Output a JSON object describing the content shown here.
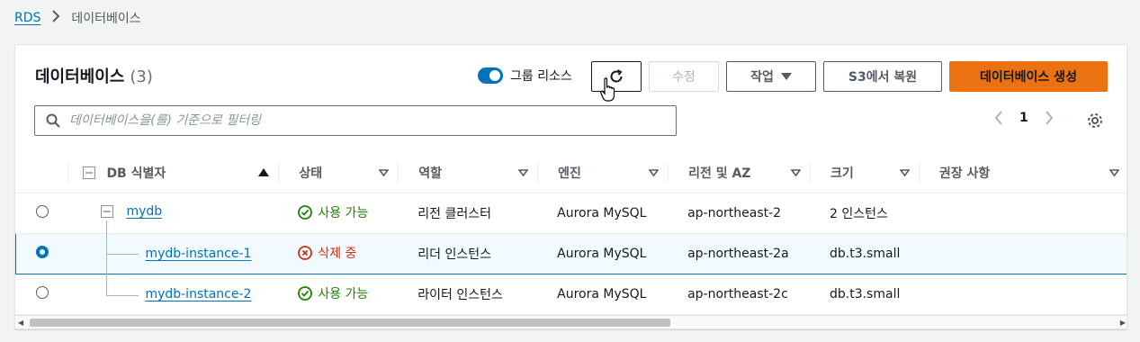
{
  "breadcrumb": {
    "root": "RDS",
    "current": "데이터베이스"
  },
  "header": {
    "title": "데이터베이스",
    "count": "(3)"
  },
  "toolbar": {
    "group_toggle_label": "그룹 리소스",
    "modify_label": "수정",
    "actions_label": "작업",
    "restore_label": "S3에서 복원",
    "create_label": "데이터베이스 생성"
  },
  "search": {
    "placeholder": "데이터베이스을(를) 기준으로 필터링",
    "value": ""
  },
  "pagination": {
    "page": "1"
  },
  "table": {
    "columns": [
      "DB 식별자",
      "상태",
      "역할",
      "엔진",
      "리전 및 AZ",
      "크기",
      "권장 사항"
    ],
    "rows": [
      {
        "id": "mydb",
        "status": "사용 가능",
        "role": "리전 클러스터",
        "engine": "Aurora MySQL",
        "region": "ap-northeast-2",
        "size": "2 인스턴스",
        "rec": ""
      },
      {
        "id": "mydb-instance-1",
        "status": "삭제 중",
        "role": "리더 인스턴스",
        "engine": "Aurora MySQL",
        "region": "ap-northeast-2a",
        "size": "db.t3.small",
        "rec": ""
      },
      {
        "id": "mydb-instance-2",
        "status": "사용 가능",
        "role": "라이터 인스턴스",
        "engine": "Aurora MySQL",
        "region": "ap-northeast-2c",
        "size": "db.t3.small",
        "rec": ""
      }
    ]
  },
  "colors": {
    "link": "#0073bb",
    "primary": "#ec7211",
    "ok": "#1d8102",
    "error": "#d13212"
  }
}
